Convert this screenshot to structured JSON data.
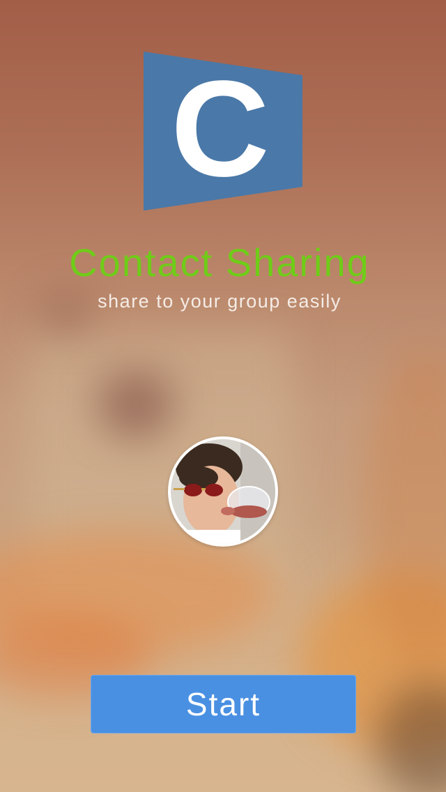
{
  "app": {
    "title": "Contact Sharing",
    "tagline": "share to your group easily",
    "logo_letter": "C",
    "logo_icon": "app-logo-c",
    "avatar_icon": "profile-photo",
    "start_label": "Start"
  },
  "colors": {
    "title": "#6fcc18",
    "logo_blue": "#4a78a8",
    "button_blue": "#4a90e2"
  }
}
